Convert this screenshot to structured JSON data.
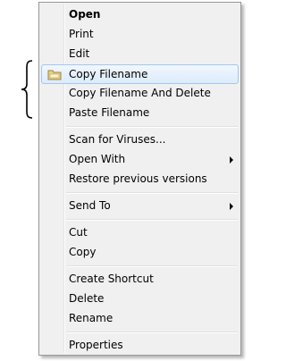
{
  "menu": {
    "items": [
      {
        "label": "Open"
      },
      {
        "label": "Print"
      },
      {
        "label": "Edit"
      },
      {
        "label": "Copy Filename"
      },
      {
        "label": "Copy Filename And Delete"
      },
      {
        "label": "Paste Filename"
      },
      {
        "label": "Scan for Viruses..."
      },
      {
        "label": "Open With"
      },
      {
        "label": "Restore previous versions"
      },
      {
        "label": "Send To"
      },
      {
        "label": "Cut"
      },
      {
        "label": "Copy"
      },
      {
        "label": "Create Shortcut"
      },
      {
        "label": "Delete"
      },
      {
        "label": "Rename"
      },
      {
        "label": "Properties"
      }
    ]
  },
  "icons": {
    "copy_filename": "folder-icon"
  },
  "colors": {
    "highlight_border": "#a5c7ef",
    "menu_background": "#f0f0f0"
  }
}
